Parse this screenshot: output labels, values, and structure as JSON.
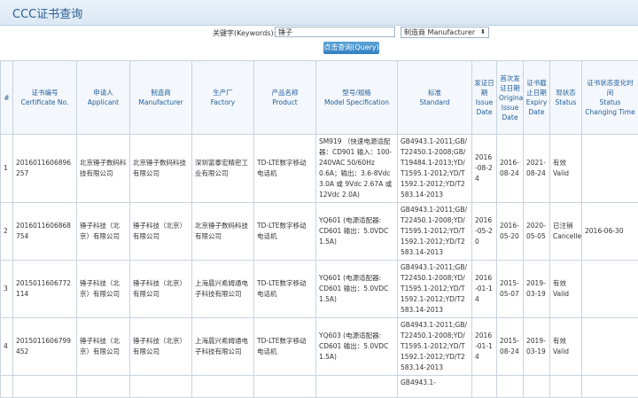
{
  "header": {
    "title": "CCC证书查询"
  },
  "search": {
    "keyword_label": "关键字(Keywords):",
    "keyword_value": "锤子",
    "field_selected": "制造商 Manufacturer",
    "button_label": "点击查询(Query)"
  },
  "columns": [
    {
      "cn": "#",
      "en": ""
    },
    {
      "cn": "证书编号",
      "en": "Certificate No."
    },
    {
      "cn": "申请人",
      "en": "Applicant"
    },
    {
      "cn": "制造商",
      "en": "Manufacturer"
    },
    {
      "cn": "生产厂",
      "en": "Factory"
    },
    {
      "cn": "产品名称",
      "en": "Product"
    },
    {
      "cn": "型号/规格",
      "en": "Model Specification"
    },
    {
      "cn": "标准",
      "en": "Standard"
    },
    {
      "cn": "发证日期",
      "en": "Issue Date"
    },
    {
      "cn": "首次发证日期",
      "en": "Original Issue Date"
    },
    {
      "cn": "证书截止日期",
      "en": "Expiry Date"
    },
    {
      "cn": "现状态",
      "en": "Status"
    },
    {
      "cn": "证书状态变化时间",
      "en": "Status Changing Time"
    }
  ],
  "rows": [
    {
      "idx": "1",
      "cert": "2016011606896257",
      "applicant": "北京锤子数码科技有限公司",
      "manufacturer": "北京锤子数码科技有限公司",
      "factory": "深圳富泰宏精密工业有限公司",
      "product": "TD-LTE数字移动电话机",
      "model": "SM919 （快速电源适配器：CD901 输入：100-240VAC 50/60Hz 0.6A；输出：3.6-8Vdc 3.0A 或 9Vdc 2.67A 或 12Vdc 2.0A)",
      "standard": "GB4943.1-2011;GB/T22450.1-2008;GB/T19484.1-2013;YD/T1595.1-2012;YD/T1592.1-2012;YD/T2583.14-2013",
      "issue": "2016-08-24",
      "original": "2016-08-24",
      "expiry": "2021-08-24",
      "status": "有效 Valid",
      "changed": ""
    },
    {
      "idx": "2",
      "cert": "2016011606868754",
      "applicant": "锤子科技（北京）有限公司",
      "manufacturer": "锤子科技（北京）有限公司",
      "factory": "北京锤子数码科技有限公司",
      "product": "TD-LTE数字移动电话机",
      "model": "YQ601 (电源适配器: CD601 输出：5.0VDC 1.5A)",
      "standard": "GB4943.1-2011;GB/T22450.1-2008;YD/T1595.1-2012;YD/T1592.1-2012;YD/T2583.14-2013",
      "issue": "2016-05-20",
      "original": "2016-05-20",
      "expiry": "2020-05-05",
      "status": "已注销 Cancelled",
      "changed": "2016-06-30"
    },
    {
      "idx": "3",
      "cert": "2015011606772114",
      "applicant": "锤子科技（北京）有限公司",
      "manufacturer": "锤子科技（北京）有限公司",
      "factory": "上海晨兴希姆通电子科技有限公司",
      "product": "TD-LTE数字移动电话机",
      "model": "YQ601 (电源适配器: CD601 输出：5.0VDC 1.5A)",
      "standard": "GB4943.1-2011;GB/T22450.1-2008;YD/T1595.1-2012;YD/T1592.1-2012;YD/T2583.14-2013",
      "issue": "2016-01-14",
      "original": "2015-05-07",
      "expiry": "2019-03-19",
      "status": "有效 Valid",
      "changed": ""
    },
    {
      "idx": "4",
      "cert": "2015011606799452",
      "applicant": "锤子科技（北京）有限公司",
      "manufacturer": "锤子科技（北京）有限公司",
      "factory": "上海晨兴希姆通电子科技有限公司",
      "product": "TD-LTE数字移动电话机",
      "model": "YQ603 (电源适配器: CD601 输出：5.0VDC 1.5A)",
      "standard": "GB4943.1-2011;GB/T22450.1-2008;YD/T1595.1-2012;YD/T1592.1-2012;YD/T2583.14-2013",
      "issue": "2016-01-14",
      "original": "2015-08-24",
      "expiry": "2019-03-19",
      "status": "有效 Valid",
      "changed": ""
    },
    {
      "idx": "",
      "cert": "",
      "applicant": "",
      "manufacturer": "",
      "factory": "",
      "product": "",
      "model": "",
      "standard": "GB4943.1-",
      "issue": "",
      "original": "",
      "expiry": "",
      "status": "",
      "changed": ""
    }
  ]
}
